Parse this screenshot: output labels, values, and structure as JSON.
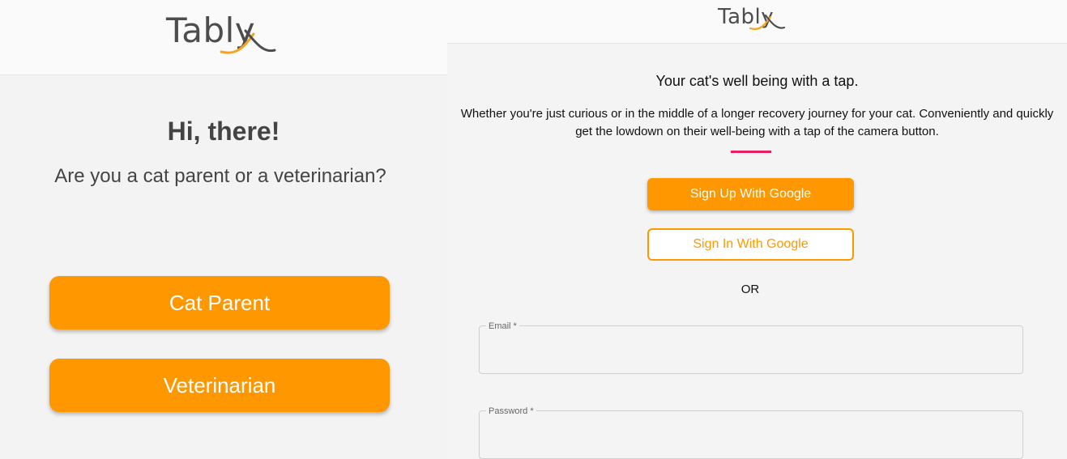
{
  "left": {
    "logo": "Tably",
    "greeting": "Hi, there!",
    "question": "Are you a cat parent or a veterinarian?",
    "cat_parent_label": "Cat Parent",
    "veterinarian_label": "Veterinarian"
  },
  "right": {
    "logo": "Tably",
    "tagline": "Your cat's well being with a tap.",
    "description": "Whether you're just curious or in the middle of a longer recovery journey for your cat. Conveniently and quickly get the lowdown on their well-being with a tap of the camera button.",
    "sign_up_label": "Sign Up With Google",
    "sign_in_label": "Sign In With Google",
    "or_text": "OR",
    "email_label": "Email *",
    "email_value": "",
    "password_label": "Password *",
    "password_value": ""
  },
  "colors": {
    "accent": "#ff9800",
    "divider": "#e91e63",
    "logo_text": "#4d4d4d",
    "logo_swoosh": "#f7a21b"
  }
}
